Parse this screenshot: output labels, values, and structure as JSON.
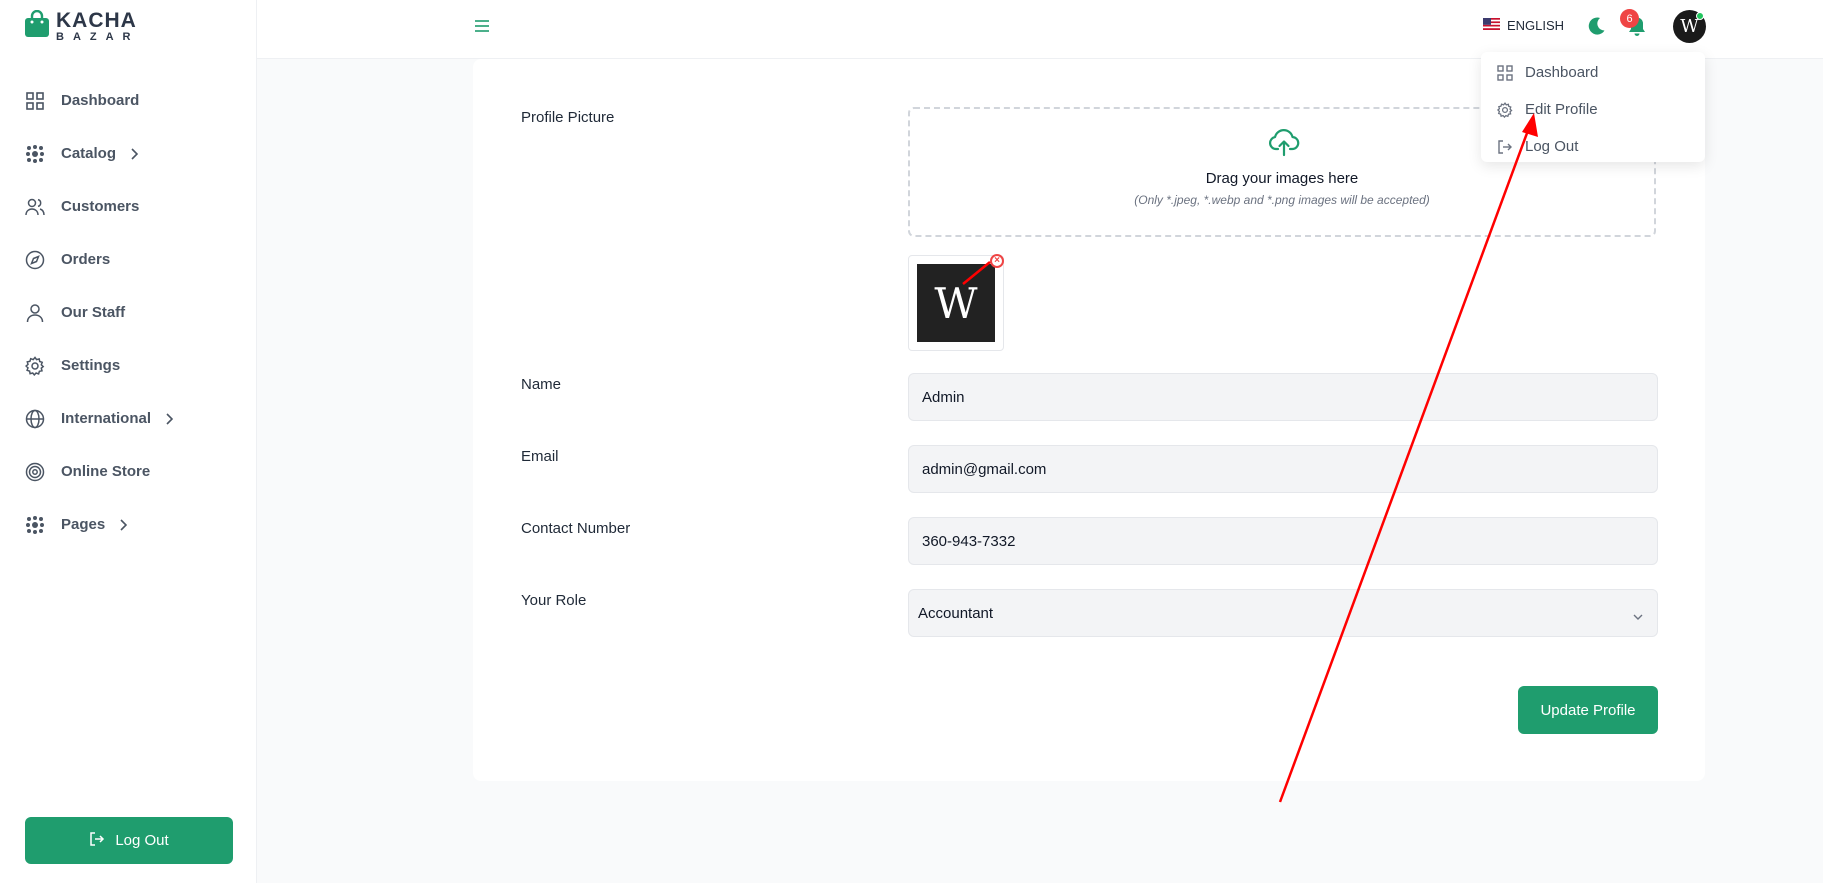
{
  "brand": {
    "line1": "KACHA",
    "line2": "BAZAR",
    "color": "#1f9d6e"
  },
  "sidebar": {
    "items": [
      {
        "label": "Dashboard",
        "icon": "grid-icon",
        "has_submenu": false
      },
      {
        "label": "Catalog",
        "icon": "catalog-icon",
        "has_submenu": true
      },
      {
        "label": "Customers",
        "icon": "users-icon",
        "has_submenu": false
      },
      {
        "label": "Orders",
        "icon": "compass-icon",
        "has_submenu": false
      },
      {
        "label": "Our Staff",
        "icon": "user-icon",
        "has_submenu": false
      },
      {
        "label": "Settings",
        "icon": "gear-icon",
        "has_submenu": false
      },
      {
        "label": "International",
        "icon": "globe-icon",
        "has_submenu": true
      },
      {
        "label": "Online Store",
        "icon": "target-icon",
        "has_submenu": false
      },
      {
        "label": "Pages",
        "icon": "pages-icon",
        "has_submenu": true
      }
    ],
    "logout_label": "Log Out"
  },
  "header": {
    "language": "ENGLISH",
    "notification_count": "6",
    "avatar_letter": "W"
  },
  "profile_menu": {
    "items": [
      {
        "label": "Dashboard",
        "icon": "grid-icon"
      },
      {
        "label": "Edit Profile",
        "icon": "gear-icon"
      },
      {
        "label": "Log Out",
        "icon": "logout-icon"
      }
    ]
  },
  "form": {
    "profile_picture_label": "Profile Picture",
    "dropzone_title": "Drag your images here",
    "dropzone_hint": "(Only *.jpeg, *.webp and *.png images will be accepted)",
    "thumbnail_letter": "W",
    "name_label": "Name",
    "name_value": "Admin",
    "email_label": "Email",
    "email_value": "admin@gmail.com",
    "contact_label": "Contact Number",
    "contact_value": "360-943-7332",
    "role_label": "Your Role",
    "role_value": "Accountant",
    "submit_label": "Update Profile"
  },
  "colors": {
    "accent": "#1f9d6e",
    "badge": "#ef4444",
    "annotation": "#ff0000"
  }
}
